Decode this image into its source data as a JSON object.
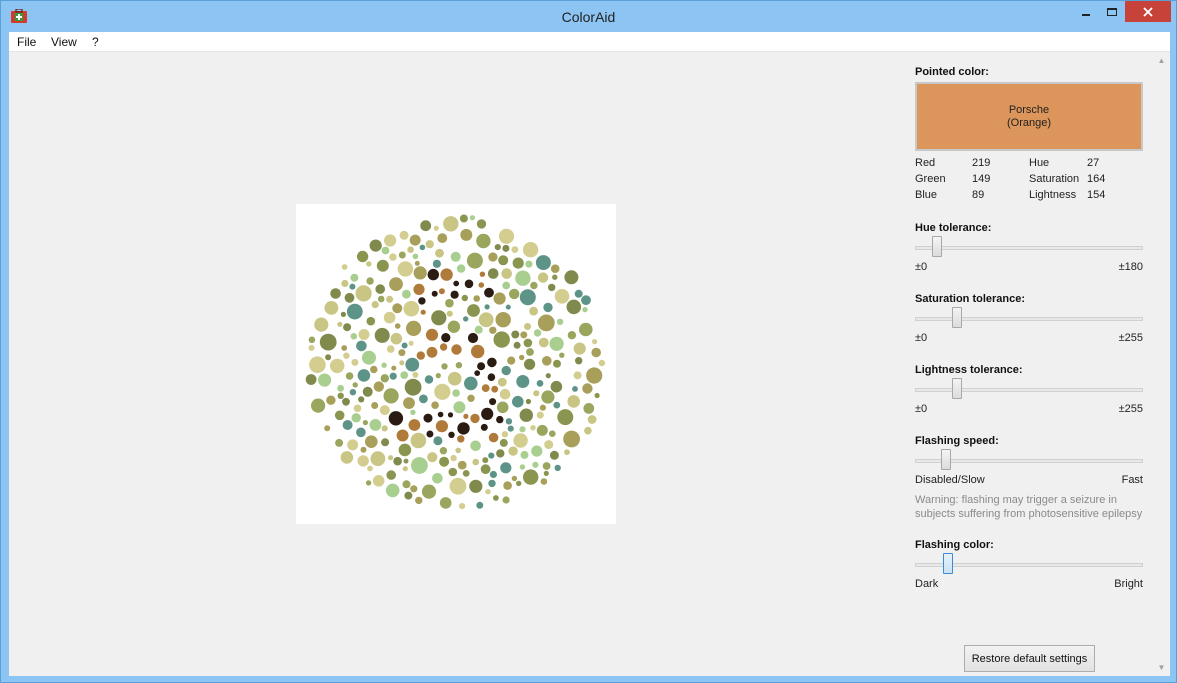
{
  "window": {
    "title": "ColorAid"
  },
  "menu": {
    "items": [
      "File",
      "View",
      "?"
    ]
  },
  "pointed": {
    "label": "Pointed color:",
    "name": "Porsche",
    "family": "(Orange)",
    "swatch_color": "#dc955a"
  },
  "color_info": {
    "red_label": "Red",
    "red": "219",
    "green_label": "Green",
    "green": "149",
    "blue_label": "Blue",
    "blue": "89",
    "hue_label": "Hue",
    "hue": "27",
    "saturation_label": "Saturation",
    "saturation": "164",
    "lightness_label": "Lightness",
    "lightness": "154"
  },
  "sliders": [
    {
      "label": "Hue tolerance:",
      "min_label": "±0",
      "max_label": "±180",
      "value": 0.08
    },
    {
      "label": "Saturation tolerance:",
      "min_label": "±0",
      "max_label": "±255",
      "value": 0.17
    },
    {
      "label": "Lightness tolerance:",
      "min_label": "±0",
      "max_label": "±255",
      "value": 0.17
    },
    {
      "label": "Flashing speed:",
      "min_label": "Disabled/Slow",
      "max_label": "Fast",
      "value": 0.12
    },
    {
      "label": "Flashing color:",
      "min_label": "Dark",
      "max_label": "Bright",
      "value": 0.13
    }
  ],
  "warning": {
    "line1": "Warning: flashing may trigger a seizure in",
    "line2": "subjects suffering from photosensitive epilepsy"
  },
  "restore_label": "Restore default settings",
  "plate": {
    "palette": [
      "#a8a05a",
      "#c9c584",
      "#7f8a4c",
      "#9aa65e",
      "#a8cf8f",
      "#5e9488",
      "#8a9650",
      "#d3cd90"
    ],
    "figure_color": "#2a1c12",
    "figure_speckle": "#b07a3a"
  },
  "colors": {
    "titlebar": "#8cc4f4",
    "close": "#c7433a",
    "client": "#f0f0f0"
  }
}
